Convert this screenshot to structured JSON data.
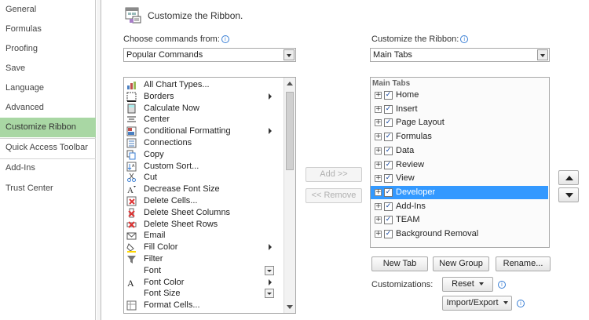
{
  "nav": {
    "items": [
      {
        "label": "General"
      },
      {
        "label": "Formulas"
      },
      {
        "label": "Proofing"
      },
      {
        "label": "Save"
      },
      {
        "label": "Language"
      },
      {
        "label": "Advanced"
      },
      {
        "label": "Customize Ribbon",
        "active": true
      },
      {
        "label": "Quick Access Toolbar"
      },
      {
        "label": "Add-Ins"
      },
      {
        "label": "Trust Center"
      }
    ]
  },
  "heading": {
    "title": "Customize the Ribbon.",
    "icon": "ribbon-customize-icon"
  },
  "left_panel": {
    "label": "Choose commands from:",
    "dropdown_value": "Popular Commands",
    "commands": [
      {
        "label": "All Chart Types...",
        "icon": "chart-icon"
      },
      {
        "label": "Borders",
        "icon": "borders-icon",
        "submenu": true
      },
      {
        "label": "Calculate Now",
        "icon": "calculator-icon"
      },
      {
        "label": "Center",
        "icon": "align-center-icon"
      },
      {
        "label": "Conditional Formatting",
        "icon": "conditional-formatting-icon",
        "submenu": true
      },
      {
        "label": "Connections",
        "icon": "connections-icon"
      },
      {
        "label": "Copy",
        "icon": "copy-icon"
      },
      {
        "label": "Custom Sort...",
        "icon": "sort-icon"
      },
      {
        "label": "Cut",
        "icon": "scissors-icon"
      },
      {
        "label": "Decrease Font Size",
        "icon": "decrease-font-icon"
      },
      {
        "label": "Delete Cells...",
        "icon": "delete-cells-icon"
      },
      {
        "label": "Delete Sheet Columns",
        "icon": "delete-columns-icon"
      },
      {
        "label": "Delete Sheet Rows",
        "icon": "delete-rows-icon"
      },
      {
        "label": "Email",
        "icon": "email-icon"
      },
      {
        "label": "Fill Color",
        "icon": "fill-color-icon",
        "submenu": true
      },
      {
        "label": "Filter",
        "icon": "filter-icon"
      },
      {
        "label": "Font",
        "icon": "font-icon",
        "combo": true
      },
      {
        "label": "Font Color",
        "icon": "font-color-icon",
        "submenu": true
      },
      {
        "label": "Font Size",
        "icon": "font-size-icon",
        "combo": true
      },
      {
        "label": "Format Cells...",
        "icon": "format-cells-icon"
      }
    ]
  },
  "middle": {
    "add_label": "Add >>",
    "remove_label": "<< Remove"
  },
  "right_panel": {
    "label": "Customize the Ribbon:",
    "dropdown_value": "Main Tabs",
    "group_header": "Main Tabs",
    "tabs": [
      {
        "label": "Home",
        "checked": true
      },
      {
        "label": "Insert",
        "checked": true
      },
      {
        "label": "Page Layout",
        "checked": true
      },
      {
        "label": "Formulas",
        "checked": true
      },
      {
        "label": "Data",
        "checked": true
      },
      {
        "label": "Review",
        "checked": true
      },
      {
        "label": "View",
        "checked": true
      },
      {
        "label": "Developer",
        "checked": true,
        "selected": true
      },
      {
        "label": "Add-Ins",
        "checked": true
      },
      {
        "label": "TEAM",
        "checked": true
      },
      {
        "label": "Background Removal",
        "checked": true
      }
    ],
    "new_tab_label": "New Tab",
    "new_group_label": "New Group",
    "rename_label": "Rename...",
    "customizations_label": "Customizations:",
    "reset_label": "Reset",
    "import_export_label": "Import/Export"
  },
  "colors": {
    "nav_active": "#a9d7a4",
    "selection": "#3399ff",
    "info": "#3a7fd5"
  }
}
